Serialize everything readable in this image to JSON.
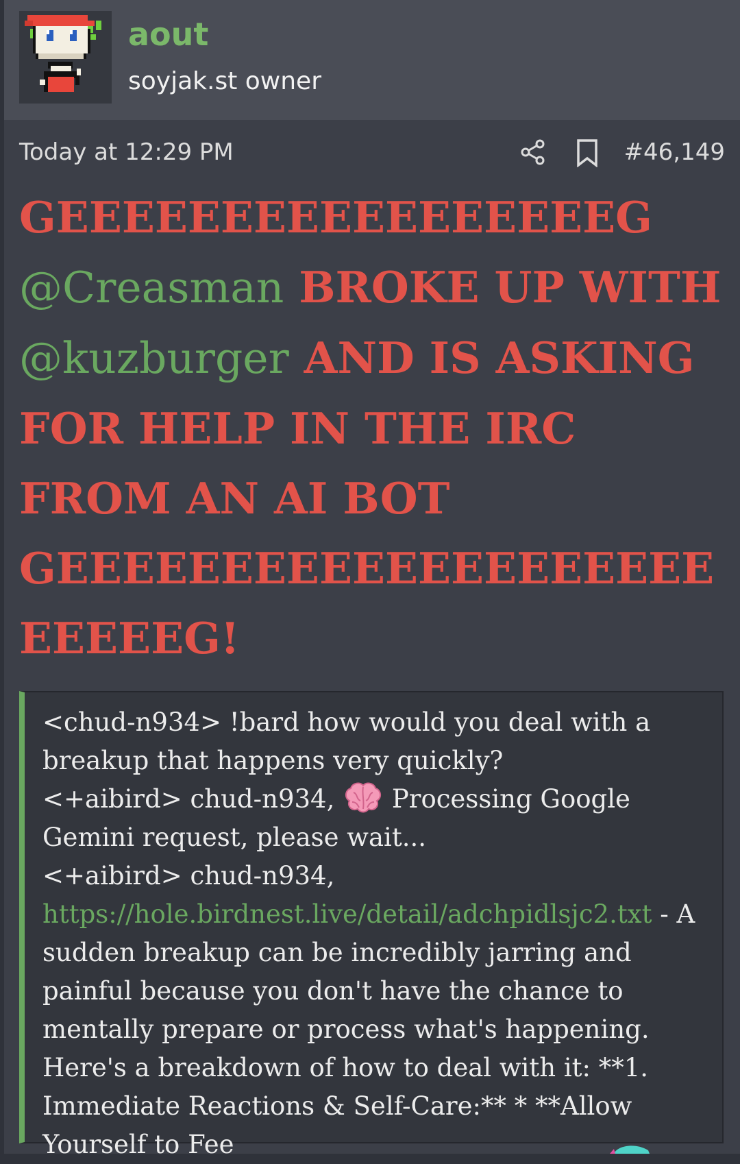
{
  "user": {
    "name": "aout",
    "title": "soyjak.st owner",
    "avatar_icon": "pixel-character-avatar"
  },
  "post": {
    "timestamp": "Today at 12:29 PM",
    "number": "#46,149",
    "share_icon": "share-icon",
    "bookmark_icon": "bookmark-icon"
  },
  "message": {
    "part1": "GEEEEEEEEEEEEEEEEEG ",
    "mention1": "@Creasman",
    "part2": " BROKE UP WITH ",
    "mention2": "@kuzburger",
    "part3": " AND IS ASKING FOR HELP IN THE IRC FROM AN AI BOT GEEEEEEEEEEEEEEEEEEEEEEEEEG!"
  },
  "quote": {
    "line1": "<chud-n934> !bard how would you deal with a breakup that happens very quickly?",
    "line2_prefix": "<+aibird> chud-n934, ",
    "line2_suffix": " Processing Google Gemini request, please wait...",
    "line3_prefix": "<+aibird> chud-n934, ",
    "link": "https://hole.birdnest.live/detail/adchpidlsjc2.txt",
    "line3_suffix": " - A sudden breakup can be incredibly jarring and painful because you don't have the chance to mentally prepare or process what's happening. Here's a breakdown of how to deal with it: **1. Immediate Reactions & Self-Care:** * **Allow Yourself to Fee",
    "brain_icon": "brain-emoji-icon"
  },
  "colors": {
    "accent_green": "#6aa860",
    "headline_red": "#e2534a",
    "background": "#3c3f48"
  }
}
